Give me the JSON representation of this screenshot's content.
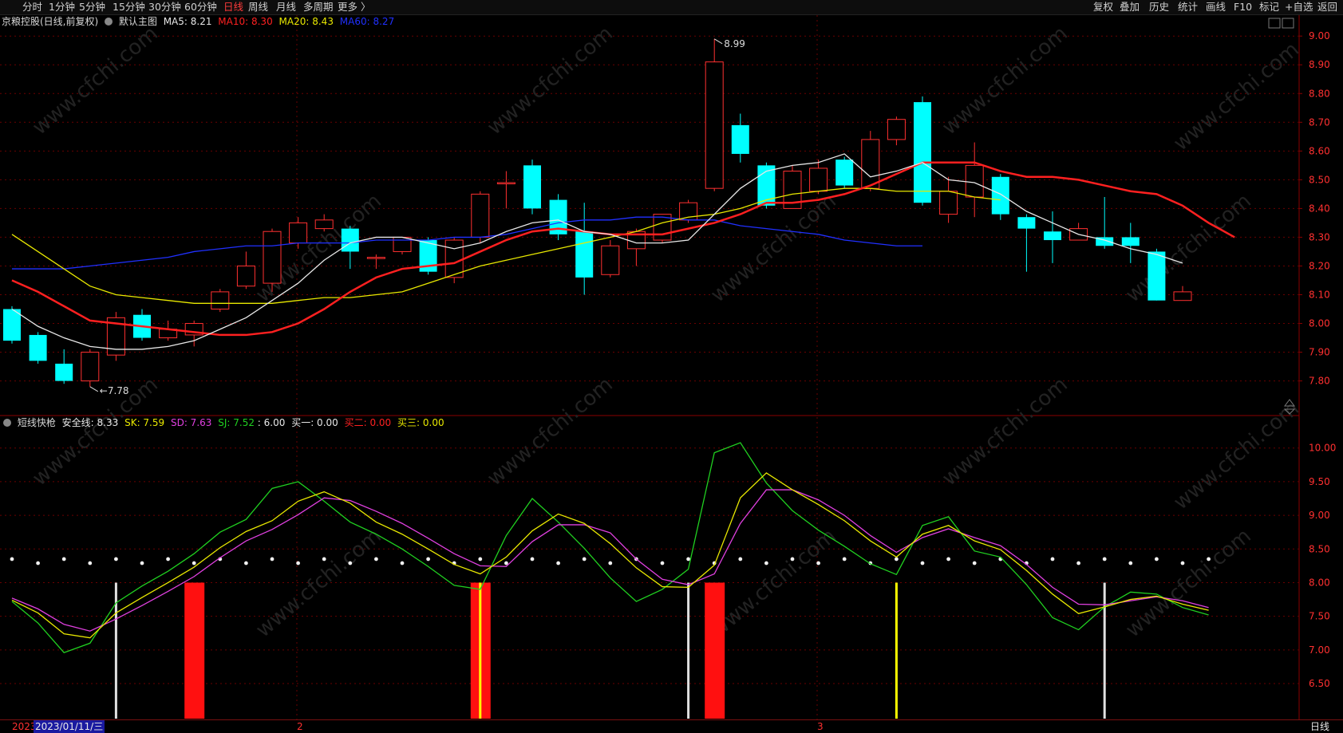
{
  "toolbar": {
    "tabs": [
      "分时",
      "1分钟",
      "5分钟",
      "15分钟",
      "30分钟",
      "60分钟",
      "日线",
      "周线",
      "月线",
      "多周期",
      "更多 〉"
    ],
    "active": "日线",
    "right_tabs": [
      "复权",
      "叠加",
      "历史",
      "统计",
      "画线",
      "F10",
      "标记",
      "+自选",
      "返回"
    ]
  },
  "main_legend": {
    "title": "京粮控股(日线,前复权)",
    "template": "默认主图",
    "ma5": "MA5: 8.21",
    "ma10": "MA10: 8.30",
    "ma20": "MA20: 8.43",
    "ma60": "MA60: 8.27"
  },
  "sub_legend": {
    "title": "短线快枪",
    "safe": "安全线: 8.33",
    "sk": "SK: 7.59",
    "sd": "SD: 7.63",
    "sj": "SJ: 7.52",
    "extra": ": 6.00",
    "buy1": "买一: 0.00",
    "buy2": "买二: 0.00",
    "buy3": "买三: 0.00"
  },
  "colors": {
    "up": "#ff3030",
    "down": "#00ffff",
    "ma5": "#e8e8e8",
    "ma10": "#ff2020",
    "ma20": "#e8e800",
    "ma60": "#2030ff",
    "sk": "#e8e800",
    "sd": "#e040e0",
    "sj": "#20d020",
    "grid": "#6a0000",
    "axis_text": "#ff3030"
  },
  "watermark": "www.cfchi.com",
  "annotations": {
    "high": "8.99",
    "low": "7.78"
  },
  "bottom": {
    "date_a": "2023",
    "date_b": "2023/01/11/三",
    "month2": "2",
    "month3": "3",
    "period": "日线"
  },
  "chart_data": [
    {
      "type": "candlestick",
      "y_ticks": [
        9.0,
        8.9,
        8.8,
        8.7,
        8.6,
        8.5,
        8.4,
        8.3,
        8.2,
        8.1,
        8.0,
        7.9,
        7.8
      ],
      "ylim": [
        7.76,
        9.02
      ],
      "candles": [
        {
          "o": 8.05,
          "c": 7.94,
          "h": 8.06,
          "l": 7.93
        },
        {
          "o": 7.96,
          "c": 7.87,
          "h": 7.97,
          "l": 7.86
        },
        {
          "o": 7.86,
          "c": 7.8,
          "h": 7.91,
          "l": 7.79
        },
        {
          "o": 7.8,
          "c": 7.9,
          "h": 7.91,
          "l": 7.78
        },
        {
          "o": 7.89,
          "c": 8.02,
          "h": 8.04,
          "l": 7.87
        },
        {
          "o": 8.03,
          "c": 7.95,
          "h": 8.05,
          "l": 7.94
        },
        {
          "o": 7.95,
          "c": 7.98,
          "h": 8.01,
          "l": 7.94
        },
        {
          "o": 7.96,
          "c": 8.0,
          "h": 8.01,
          "l": 7.92
        },
        {
          "o": 8.05,
          "c": 8.11,
          "h": 8.12,
          "l": 8.04
        },
        {
          "o": 8.13,
          "c": 8.2,
          "h": 8.25,
          "l": 8.12
        },
        {
          "o": 8.14,
          "c": 8.32,
          "h": 8.33,
          "l": 8.11
        },
        {
          "o": 8.28,
          "c": 8.35,
          "h": 8.37,
          "l": 8.26
        },
        {
          "o": 8.33,
          "c": 8.36,
          "h": 8.38,
          "l": 8.32
        },
        {
          "o": 8.33,
          "c": 8.25,
          "h": 8.34,
          "l": 8.19
        },
        {
          "o": 8.23,
          "c": 8.23,
          "h": 8.24,
          "l": 8.19
        },
        {
          "o": 8.25,
          "c": 8.3,
          "h": 8.3,
          "l": 8.24
        },
        {
          "o": 8.29,
          "c": 8.18,
          "h": 8.3,
          "l": 8.17
        },
        {
          "o": 8.16,
          "c": 8.29,
          "h": 8.3,
          "l": 8.14
        },
        {
          "o": 8.3,
          "c": 8.45,
          "h": 8.46,
          "l": 8.28
        },
        {
          "o": 8.49,
          "c": 8.49,
          "h": 8.53,
          "l": 8.4
        },
        {
          "o": 8.55,
          "c": 8.4,
          "h": 8.57,
          "l": 8.38
        },
        {
          "o": 8.43,
          "c": 8.31,
          "h": 8.45,
          "l": 8.29
        },
        {
          "o": 8.32,
          "c": 8.16,
          "h": 8.42,
          "l": 8.1
        },
        {
          "o": 8.17,
          "c": 8.27,
          "h": 8.29,
          "l": 8.16
        },
        {
          "o": 8.26,
          "c": 8.32,
          "h": 8.33,
          "l": 8.2
        },
        {
          "o": 8.29,
          "c": 8.38,
          "h": 8.38,
          "l": 8.28
        },
        {
          "o": 8.36,
          "c": 8.42,
          "h": 8.43,
          "l": 8.35
        },
        {
          "o": 8.47,
          "c": 8.91,
          "h": 8.99,
          "l": 8.46
        },
        {
          "o": 8.69,
          "c": 8.59,
          "h": 8.73,
          "l": 8.56
        },
        {
          "o": 8.55,
          "c": 8.41,
          "h": 8.56,
          "l": 8.4
        },
        {
          "o": 8.4,
          "c": 8.53,
          "h": 8.55,
          "l": 8.4
        },
        {
          "o": 8.46,
          "c": 8.54,
          "h": 8.57,
          "l": 8.45
        },
        {
          "o": 8.57,
          "c": 8.48,
          "h": 8.58,
          "l": 8.47
        },
        {
          "o": 8.47,
          "c": 8.64,
          "h": 8.67,
          "l": 8.46
        },
        {
          "o": 8.64,
          "c": 8.71,
          "h": 8.72,
          "l": 8.62
        },
        {
          "o": 8.77,
          "c": 8.42,
          "h": 8.79,
          "l": 8.41
        },
        {
          "o": 8.38,
          "c": 8.46,
          "h": 8.51,
          "l": 8.35
        },
        {
          "o": 8.44,
          "c": 8.55,
          "h": 8.63,
          "l": 8.37
        },
        {
          "o": 8.51,
          "c": 8.38,
          "h": 8.52,
          "l": 8.36
        },
        {
          "o": 8.37,
          "c": 8.33,
          "h": 8.38,
          "l": 8.18
        },
        {
          "o": 8.32,
          "c": 8.29,
          "h": 8.39,
          "l": 8.21
        },
        {
          "o": 8.29,
          "c": 8.33,
          "h": 8.35,
          "l": 8.29
        },
        {
          "o": 8.3,
          "c": 8.27,
          "h": 8.44,
          "l": 8.26
        },
        {
          "o": 8.3,
          "c": 8.27,
          "h": 8.35,
          "l": 8.21
        },
        {
          "o": 8.25,
          "c": 8.08,
          "h": 8.26,
          "l": 8.08
        },
        {
          "o": 8.08,
          "c": 8.11,
          "h": 8.13,
          "l": 8.08
        }
      ],
      "ma5": [
        8.05,
        7.99,
        7.95,
        7.92,
        7.91,
        7.91,
        7.92,
        7.94,
        7.98,
        8.02,
        8.08,
        8.14,
        8.22,
        8.28,
        8.3,
        8.3,
        8.28,
        8.26,
        8.28,
        8.32,
        8.35,
        8.36,
        8.32,
        8.31,
        8.28,
        8.28,
        8.29,
        8.38,
        8.47,
        8.53,
        8.55,
        8.56,
        8.59,
        8.51,
        8.53,
        8.56,
        8.5,
        8.49,
        8.45,
        8.39,
        8.35,
        8.31,
        8.29,
        8.26,
        8.24,
        8.21
      ],
      "ma10": [
        8.15,
        8.11,
        8.06,
        8.01,
        8.0,
        7.99,
        7.98,
        7.97,
        7.96,
        7.96,
        7.97,
        8.0,
        8.05,
        8.11,
        8.16,
        8.19,
        8.2,
        8.21,
        8.25,
        8.29,
        8.32,
        8.33,
        8.32,
        8.31,
        8.31,
        8.31,
        8.33,
        8.35,
        8.38,
        8.42,
        8.42,
        8.43,
        8.45,
        8.48,
        8.52,
        8.56,
        8.56,
        8.56,
        8.53,
        8.51,
        8.51,
        8.5,
        8.48,
        8.46,
        8.45,
        8.41,
        8.35,
        8.3
      ],
      "ma20": [
        8.31,
        8.25,
        8.19,
        8.13,
        8.1,
        8.09,
        8.08,
        8.07,
        8.07,
        8.07,
        8.07,
        8.08,
        8.09,
        8.09,
        8.1,
        8.11,
        8.14,
        8.17,
        8.2,
        8.22,
        8.24,
        8.26,
        8.28,
        8.3,
        8.32,
        8.35,
        8.37,
        8.38,
        8.4,
        8.43,
        8.45,
        8.46,
        8.47,
        8.47,
        8.46,
        8.46,
        8.46,
        8.44,
        8.43
      ],
      "ma60": [
        8.19,
        8.19,
        8.19,
        8.2,
        8.21,
        8.22,
        8.23,
        8.25,
        8.26,
        8.27,
        8.27,
        8.28,
        8.28,
        8.28,
        8.29,
        8.29,
        8.29,
        8.3,
        8.3,
        8.31,
        8.33,
        8.35,
        8.36,
        8.36,
        8.37,
        8.37,
        8.36,
        8.36,
        8.34,
        8.33,
        8.32,
        8.31,
        8.29,
        8.28,
        8.27,
        8.27
      ]
    },
    {
      "type": "line",
      "title": "短线快枪",
      "y_ticks": [
        10.0,
        9.5,
        9.0,
        8.5,
        8.0,
        7.5,
        7.0,
        6.5
      ],
      "ylim": [
        6.05,
        10.4
      ],
      "sk": [
        7.74,
        7.55,
        7.24,
        7.18,
        7.55,
        7.78,
        8.0,
        8.23,
        8.52,
        8.76,
        8.92,
        9.21,
        9.35,
        9.18,
        8.9,
        8.72,
        8.5,
        8.27,
        8.13,
        8.38,
        8.77,
        9.02,
        8.88,
        8.58,
        8.22,
        7.94,
        7.93,
        8.26,
        9.26,
        9.63,
        9.38,
        9.16,
        8.92,
        8.62,
        8.38,
        8.72,
        8.85,
        8.62,
        8.49,
        8.18,
        7.83,
        7.54,
        7.64,
        7.75,
        7.8,
        7.68,
        7.59
      ],
      "sd": [
        7.77,
        7.61,
        7.38,
        7.28,
        7.46,
        7.66,
        7.87,
        8.09,
        8.37,
        8.62,
        8.79,
        9.01,
        9.26,
        9.22,
        9.06,
        8.88,
        8.66,
        8.43,
        8.25,
        8.24,
        8.61,
        8.86,
        8.86,
        8.74,
        8.35,
        8.05,
        7.97,
        8.13,
        8.88,
        9.38,
        9.38,
        9.23,
        9.0,
        8.7,
        8.45,
        8.67,
        8.8,
        8.67,
        8.55,
        8.27,
        7.93,
        7.68,
        7.67,
        7.73,
        7.79,
        7.73,
        7.63
      ],
      "sj": [
        7.72,
        7.4,
        6.96,
        7.1,
        7.7,
        7.95,
        8.17,
        8.43,
        8.75,
        8.94,
        9.4,
        9.5,
        9.21,
        8.9,
        8.72,
        8.5,
        8.24,
        7.96,
        7.9,
        8.7,
        9.25,
        8.9,
        8.51,
        8.07,
        7.72,
        7.9,
        8.2,
        9.93,
        10.08,
        9.48,
        9.07,
        8.78,
        8.54,
        8.28,
        8.12,
        8.85,
        8.98,
        8.47,
        8.38,
        7.97,
        7.48,
        7.3,
        7.64,
        7.86,
        7.83,
        7.63,
        7.52
      ],
      "safe_line": 8.33,
      "signals_white_idx": [
        4,
        26,
        42
      ],
      "signals_red_idx": [
        7,
        18,
        27
      ],
      "signals_yellow_idx": [
        18,
        34
      ]
    }
  ]
}
